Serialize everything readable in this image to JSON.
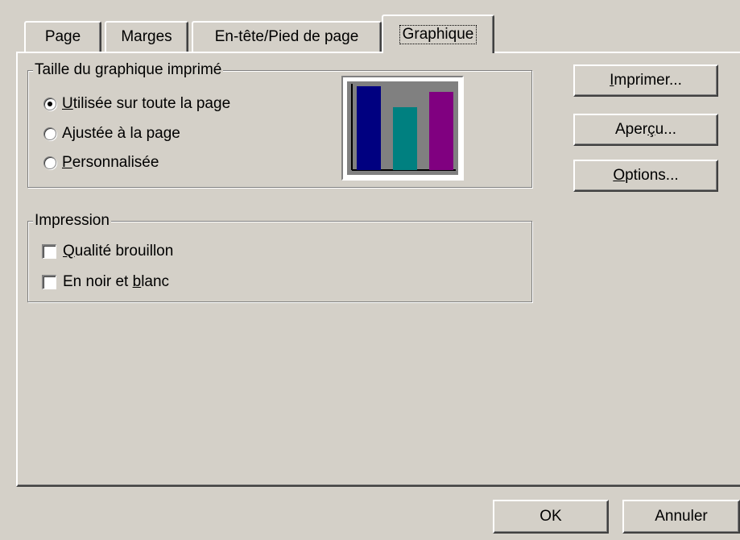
{
  "tabs": [
    {
      "label": "Page"
    },
    {
      "label": "Marges"
    },
    {
      "label": "En-tête/Pied de page"
    },
    {
      "label": "Graphique",
      "active": true
    }
  ],
  "size_group": {
    "title": "Taille du graphique imprimé",
    "options": [
      {
        "pre": "",
        "u": "U",
        "post": "tilisée sur toute la page",
        "selected": true
      },
      {
        "pre": "A",
        "u": "j",
        "post": "ustée à la page",
        "selected": false
      },
      {
        "pre": "",
        "u": "P",
        "post": "ersonnalisée",
        "selected": false
      }
    ]
  },
  "preview": {
    "bars": [
      {
        "value": 1.0,
        "color": "#000080"
      },
      {
        "value": 0.75,
        "color": "#008080"
      },
      {
        "value": 0.93,
        "color": "#800080"
      }
    ]
  },
  "print_group": {
    "title": "Impression",
    "options": [
      {
        "pre": "",
        "u": "Q",
        "post": "ualité brouillon",
        "checked": false
      },
      {
        "pre": "En noir et ",
        "u": "b",
        "post": "lanc",
        "checked": false
      }
    ]
  },
  "side_buttons": [
    {
      "pre": "",
      "u": "I",
      "post": "mprimer..."
    },
    {
      "pre": "Aper",
      "u": "ç",
      "post": "u..."
    },
    {
      "pre": "",
      "u": "O",
      "post": "ptions..."
    }
  ],
  "footer": {
    "ok": "OK",
    "cancel": "Annuler"
  }
}
